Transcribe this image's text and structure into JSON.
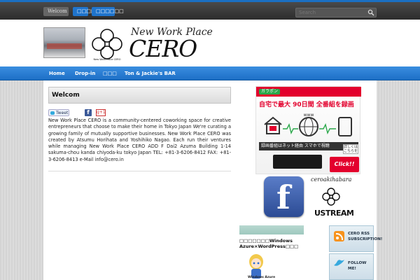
{
  "topbar": {
    "tabs": [
      "Welcom",
      "□□□□",
      "□□□□□□"
    ],
    "search_placeholder": "Search",
    "accent": "#1b6fc2"
  },
  "header": {
    "logo_sub": "New Work Place",
    "logo_main": "CERO",
    "logo_tiny": "New Work Place CERO"
  },
  "nav": {
    "items": [
      "Home",
      "Drop-in",
      "□□□",
      "Ton & Jackie's BAR"
    ],
    "color": "#2d84d8"
  },
  "post": {
    "title": "Welcom",
    "tweet_label": "Tweet",
    "fb_label": "f",
    "gplus_label": "g+1",
    "body": "New Work Place CERO  is a community-centered coworking space for creative entrepreneurs that choose to make their home in Tokyo Japan  We're curating a growing family of mutually supportive businesses. New Work Place CERO was created by Atsumu Horihata and Yoshihiko Nagao. Each run their ventures while managing New Work Place CERO ADD  F Dai2 Azuma Building 1-14 sakuma-chou kanda chiyoda-ku tokyo Japan TEL: +81-3-6206-8412 FAX: +81-3-6206-8413 e-Mail info@cero.in"
  },
  "ad": {
    "brand": "ガラポン",
    "headline": "自宅で最大 90日間 全番組を録画",
    "www": "www",
    "band": "録画番組はネット経由 スマホで視聴",
    "note": "詳しくは こちらを",
    "click": "Click!!"
  },
  "sidebar": {
    "fb_letter": "f",
    "cero_label": "ceroakihabara",
    "ustream_label": "USTREAM",
    "widget_title": "□□□□□□□Windows Azure×WordPress□□□",
    "avatar_caption": "Windows Azure",
    "rss_label": "CERO RSS SUBSCRIPTION!",
    "follow_label": "FOLLOW ME!"
  }
}
